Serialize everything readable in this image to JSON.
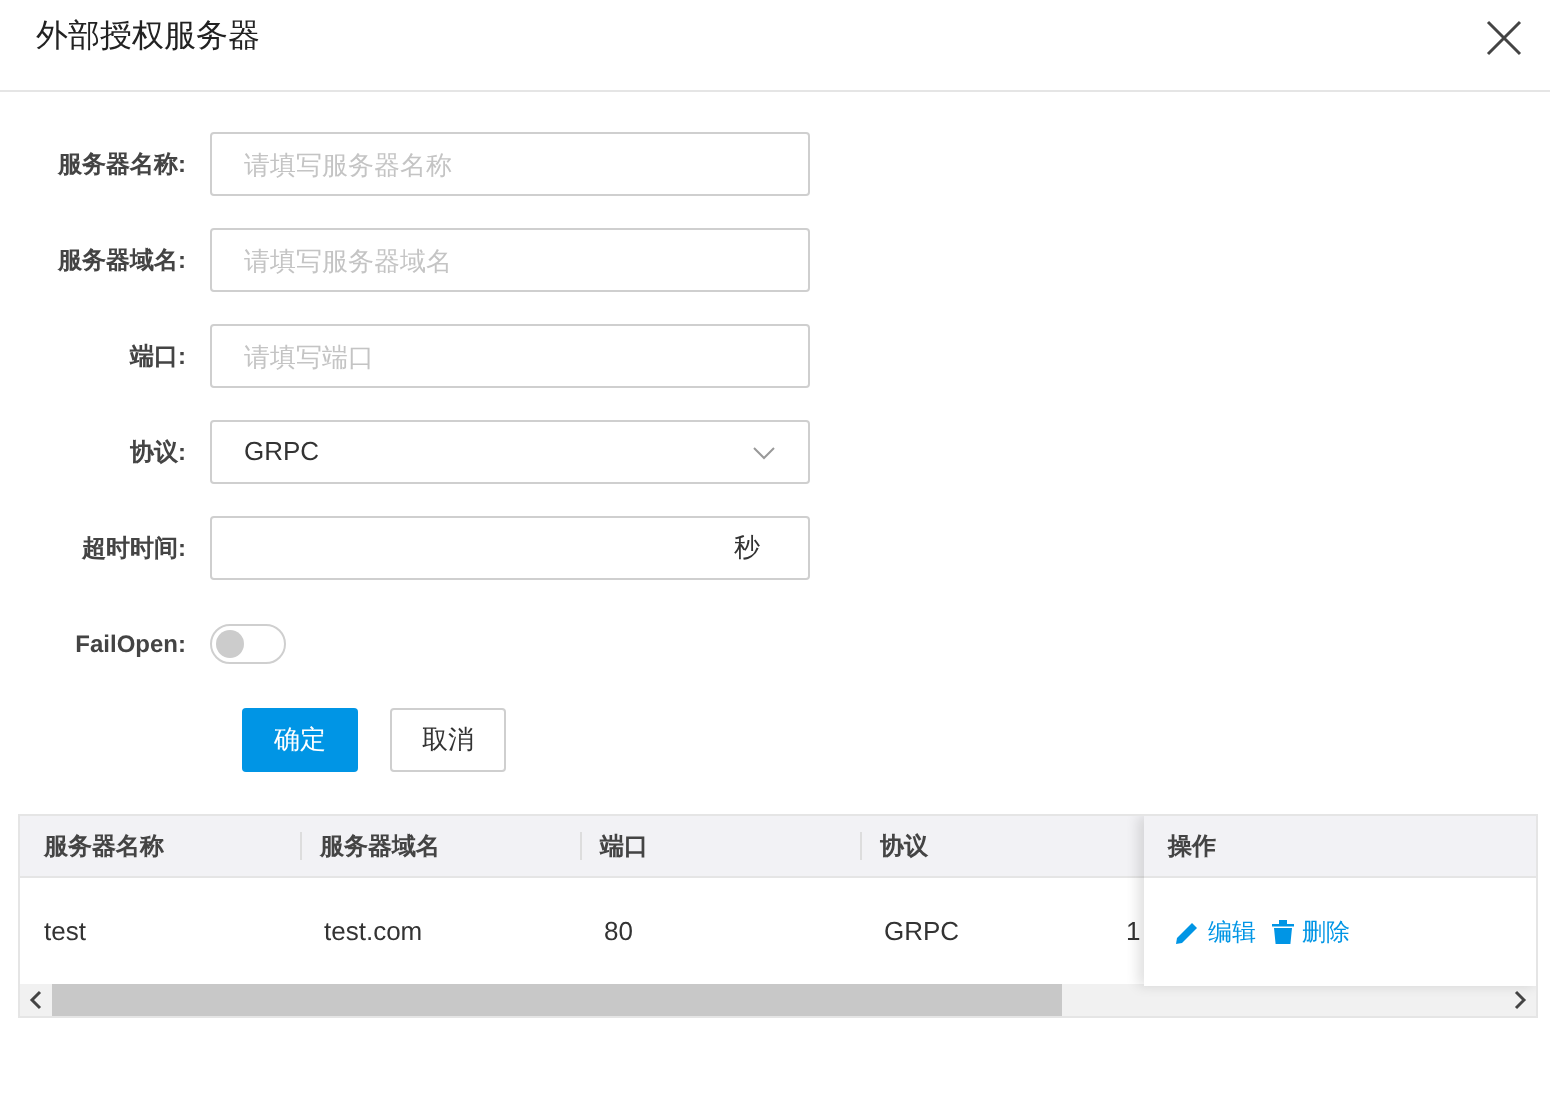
{
  "dialog": {
    "title": "外部授权服务器"
  },
  "form": [
    {
      "kind": "input",
      "label": "服务器名称:",
      "placeholder": "请填写服务器名称"
    },
    {
      "kind": "input",
      "label": "服务器域名:",
      "placeholder": "请填写服务器域名"
    },
    {
      "kind": "input",
      "label": "端口:",
      "placeholder": "请填写端口"
    },
    {
      "kind": "select",
      "label": "协议:",
      "value": "GRPC"
    },
    {
      "kind": "suffix",
      "label": "超时时间:",
      "suffix": "秒"
    },
    {
      "kind": "switch",
      "label": "FailOpen:",
      "on": false
    }
  ],
  "buttons": [
    {
      "kind": "primary",
      "label": "确定"
    },
    {
      "kind": "default",
      "label": "取消"
    }
  ],
  "table": {
    "columns": [
      "服务器名称",
      "服务器域名",
      "端口",
      "协议"
    ],
    "fixed_column": "操作",
    "rows": [
      {
        "cells": [
          "test",
          "test.com",
          "80",
          "GRPC",
          "1"
        ],
        "actions": [
          "编辑",
          "删除"
        ]
      }
    ]
  }
}
